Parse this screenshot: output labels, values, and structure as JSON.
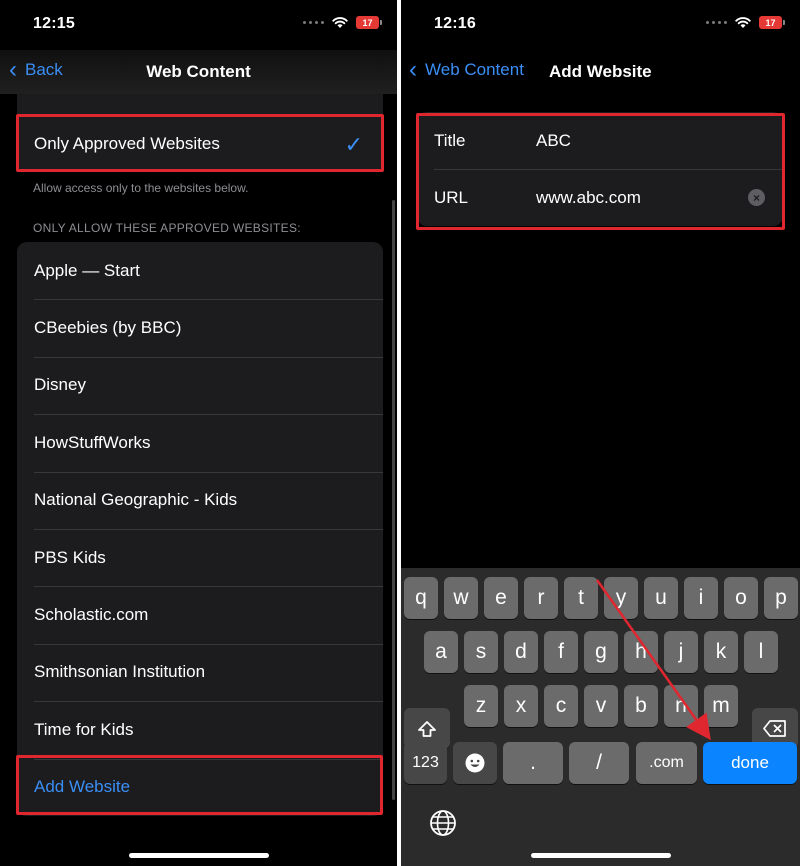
{
  "left": {
    "status": {
      "time": "12:15",
      "battery": "17"
    },
    "nav": {
      "back_label": "Back",
      "title": "Web Content"
    },
    "selected_option": "Only Approved Websites",
    "footnote": "Allow access only to the websites below.",
    "section_header": "ONLY ALLOW THESE APPROVED WEBSITES:",
    "websites": [
      "Apple — Start",
      "CBeebies (by BBC)",
      "Disney",
      "HowStuffWorks",
      "National Geographic - Kids",
      "PBS Kids",
      "Scholastic.com",
      "Smithsonian Institution",
      "Time for Kids"
    ],
    "add_website_label": "Add Website"
  },
  "right": {
    "status": {
      "time": "12:16",
      "battery": "17"
    },
    "nav": {
      "back_label": "Web Content",
      "title": "Add Website"
    },
    "form": {
      "title_label": "Title",
      "title_value": "ABC",
      "url_label": "URL",
      "url_value": "www.abc.com"
    },
    "keyboard": {
      "row1": [
        "q",
        "w",
        "e",
        "r",
        "t",
        "y",
        "u",
        "i",
        "o",
        "p"
      ],
      "row2": [
        "a",
        "s",
        "d",
        "f",
        "g",
        "h",
        "j",
        "k",
        "l"
      ],
      "row3": [
        "z",
        "x",
        "c",
        "v",
        "b",
        "n",
        "m"
      ],
      "numbers_key": "123",
      "dot_key": ".",
      "slash_key": "/",
      "dotcom_key": ".com",
      "done_key": "done"
    }
  },
  "colors": {
    "accent": "#3a8ef5",
    "highlight": "#e0262e",
    "done": "#0a84ff"
  }
}
